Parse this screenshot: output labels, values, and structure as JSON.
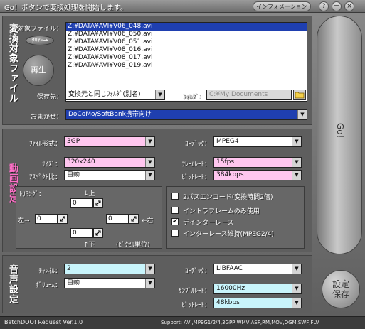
{
  "window": {
    "title": "Go！ボタンで変換処理を開始します。",
    "info_button": "インフォメーション",
    "help_icon": "?",
    "minimize_icon": "－",
    "close_icon": "×"
  },
  "files_section": {
    "title": "変換対象ファイル",
    "target_label": "対象ファイル：",
    "clear_button": "ｸﾘｱｰ→",
    "play_button": "再生",
    "files": [
      "Z:¥DATA¥AVI¥V06_048.avi",
      "Z:¥DATA¥AVI¥V06_050.avi",
      "Z:¥DATA¥AVI¥V06_051.avi",
      "Z:¥DATA¥AVI¥V08_016.avi",
      "Z:¥DATA¥AVI¥V08_017.avi",
      "Z:¥DATA¥AVI¥V08_019.avi"
    ],
    "save_label": "保存先：",
    "save_value": "変換元と同じﾌｫﾙﾀﾞ(別名)",
    "folder_label": "ﾌｫﾙﾀﾞ：",
    "folder_value": "C:¥My Documents",
    "preset_label": "おまかせ：",
    "preset_value": "DoCoMo/SoftBank携帯向け"
  },
  "video_section": {
    "title": "動画設定",
    "format_label": "ﾌｧｲﾙ形式：",
    "format_value": "3GP",
    "size_label": "ｻｲｽﾞ：",
    "size_value": "320x240",
    "aspect_label": "ｱｽﾍﾟｸﾄ比：",
    "aspect_value": "自動",
    "codec_label": "ｺｰﾃﾞｯｸ：",
    "codec_value": "MPEG4",
    "framerate_label": "ﾌﾚｰﾑﾚｰﾄ：",
    "framerate_value": "15fps",
    "bitrate_label": "ﾋﾞｯﾄﾚｰﾄ：",
    "bitrate_value": "384kbps",
    "trim_label": "ﾄﾘﾐﾝｸﾞ：",
    "trim_top_label": "↓上",
    "trim_left_label": "左→",
    "trim_right_label": "←右",
    "trim_bottom_label": "↑下",
    "trim_unit_label": "(ﾋﾟｸｾﾙ単位)",
    "trim_top": "0",
    "trim_left": "0",
    "trim_right": "0",
    "trim_bottom": "0",
    "options": [
      {
        "label": "2パスエンコード(変換時間2倍)",
        "checked": false,
        "mark": ""
      },
      {
        "label": "イントラフレームのみ使用",
        "checked": false,
        "mark": ""
      },
      {
        "label": "デインターレース",
        "checked": true,
        "mark": "✔"
      },
      {
        "label": "インターレース維持(MPEG2/4)",
        "checked": false,
        "mark": ""
      }
    ]
  },
  "audio_section": {
    "title": "音声設定",
    "channel_label": "ﾁｬﾝﾈﾙ：",
    "channel_value": "2",
    "volume_label": "ﾎﾞﾘｭｰﾑ：",
    "volume_value": "自動",
    "codec_label": "ｺｰﾃﾞｯｸ：",
    "codec_value": "LIBFAAC",
    "samplerate_label": "ｻﾝﾌﾟﾙﾚｰﾄ：",
    "samplerate_value": "16000Hz",
    "bitrate_label": "ﾋﾞｯﾄﾚｰﾄ：",
    "bitrate_value": "48kbps"
  },
  "actions": {
    "go_label": "Go!",
    "save_settings_line1": "設定",
    "save_settings_line2": "保存"
  },
  "status": {
    "app_version": "BatchDOO! Request Ver.1.0",
    "support": "Support: AVI,MPEG1/2/4,3GPP,WMV,ASF,RM,MOV,OGM,SWF,FLV"
  },
  "icons": {
    "dropdown": "chevron-down-icon",
    "folder": "folder-icon",
    "spin": "spin-icon"
  },
  "colors": {
    "video_field": "#ffc6ef",
    "audio_field": "#c8f4fb",
    "selection": "#1f3fb0",
    "video_title": "#ff70c8"
  }
}
